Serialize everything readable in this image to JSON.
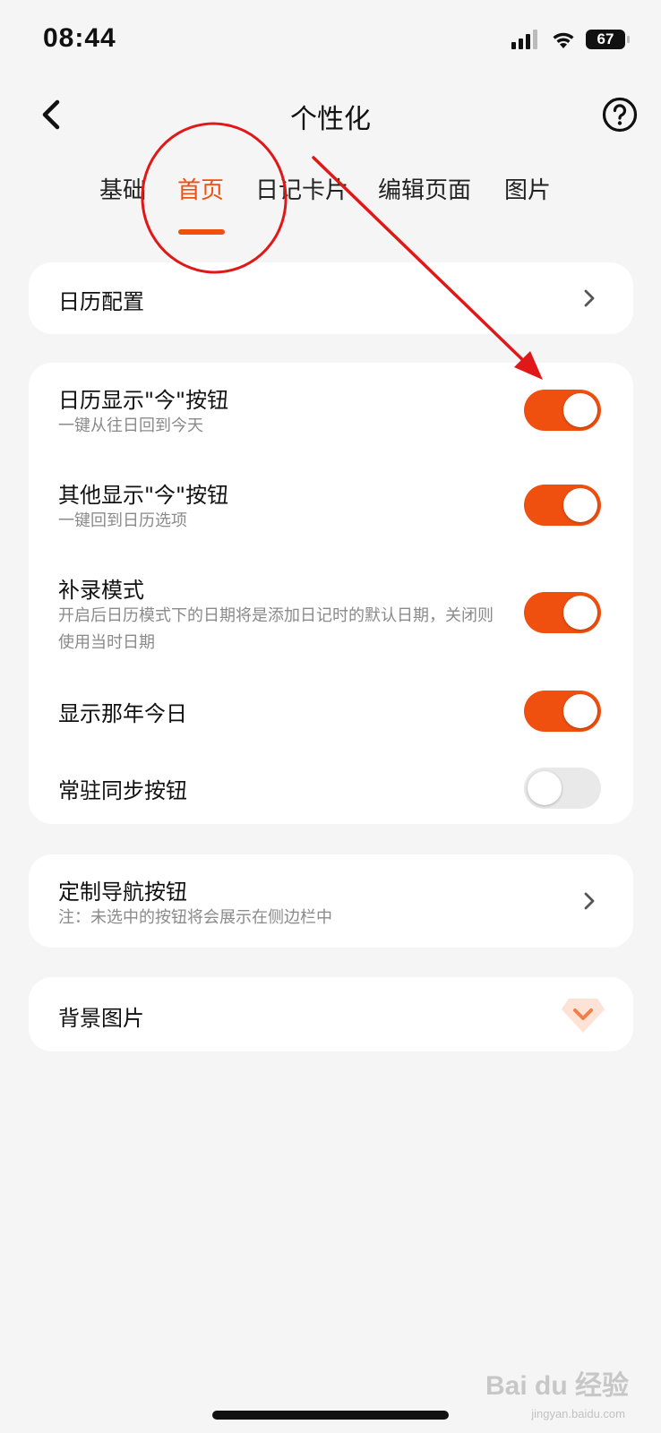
{
  "status_bar": {
    "time": "08:44",
    "battery": "67"
  },
  "nav": {
    "title": "个性化",
    "back_icon": "chevron-left-icon",
    "help_icon": "question-circle-icon"
  },
  "tabs": [
    {
      "label": "基础",
      "active": false
    },
    {
      "label": "首页",
      "active": true
    },
    {
      "label": "日记卡片",
      "active": false
    },
    {
      "label": "编辑页面",
      "active": false
    },
    {
      "label": "图片",
      "active": false
    }
  ],
  "calendar_config": {
    "title": "日历配置"
  },
  "settings": [
    {
      "title": "日历显示\"今\"按钮",
      "subtitle": "一键从往日回到今天",
      "enabled": true
    },
    {
      "title": "其他显示\"今\"按钮",
      "subtitle": "一键回到日历选项",
      "enabled": true
    },
    {
      "title": "补录模式",
      "subtitle": "开启后日历模式下的日期将是添加日记时的默认日期，关闭则使用当时日期",
      "enabled": true
    },
    {
      "title": "显示那年今日",
      "subtitle": "",
      "enabled": true
    },
    {
      "title": "常驻同步按钮",
      "subtitle": "",
      "enabled": false
    }
  ],
  "custom_nav": {
    "title": "定制导航按钮",
    "subtitle": "注：未选中的按钮将会展示在侧边栏中"
  },
  "background_image": {
    "title": "背景图片",
    "badge_icon": "premium-diamond-icon"
  },
  "watermark": {
    "text": "Bai du 经验",
    "sub": "jingyan.baidu.com"
  },
  "colors": {
    "accent": "#f0500f",
    "annotation": "#e01818",
    "background": "#f5f5f5"
  }
}
